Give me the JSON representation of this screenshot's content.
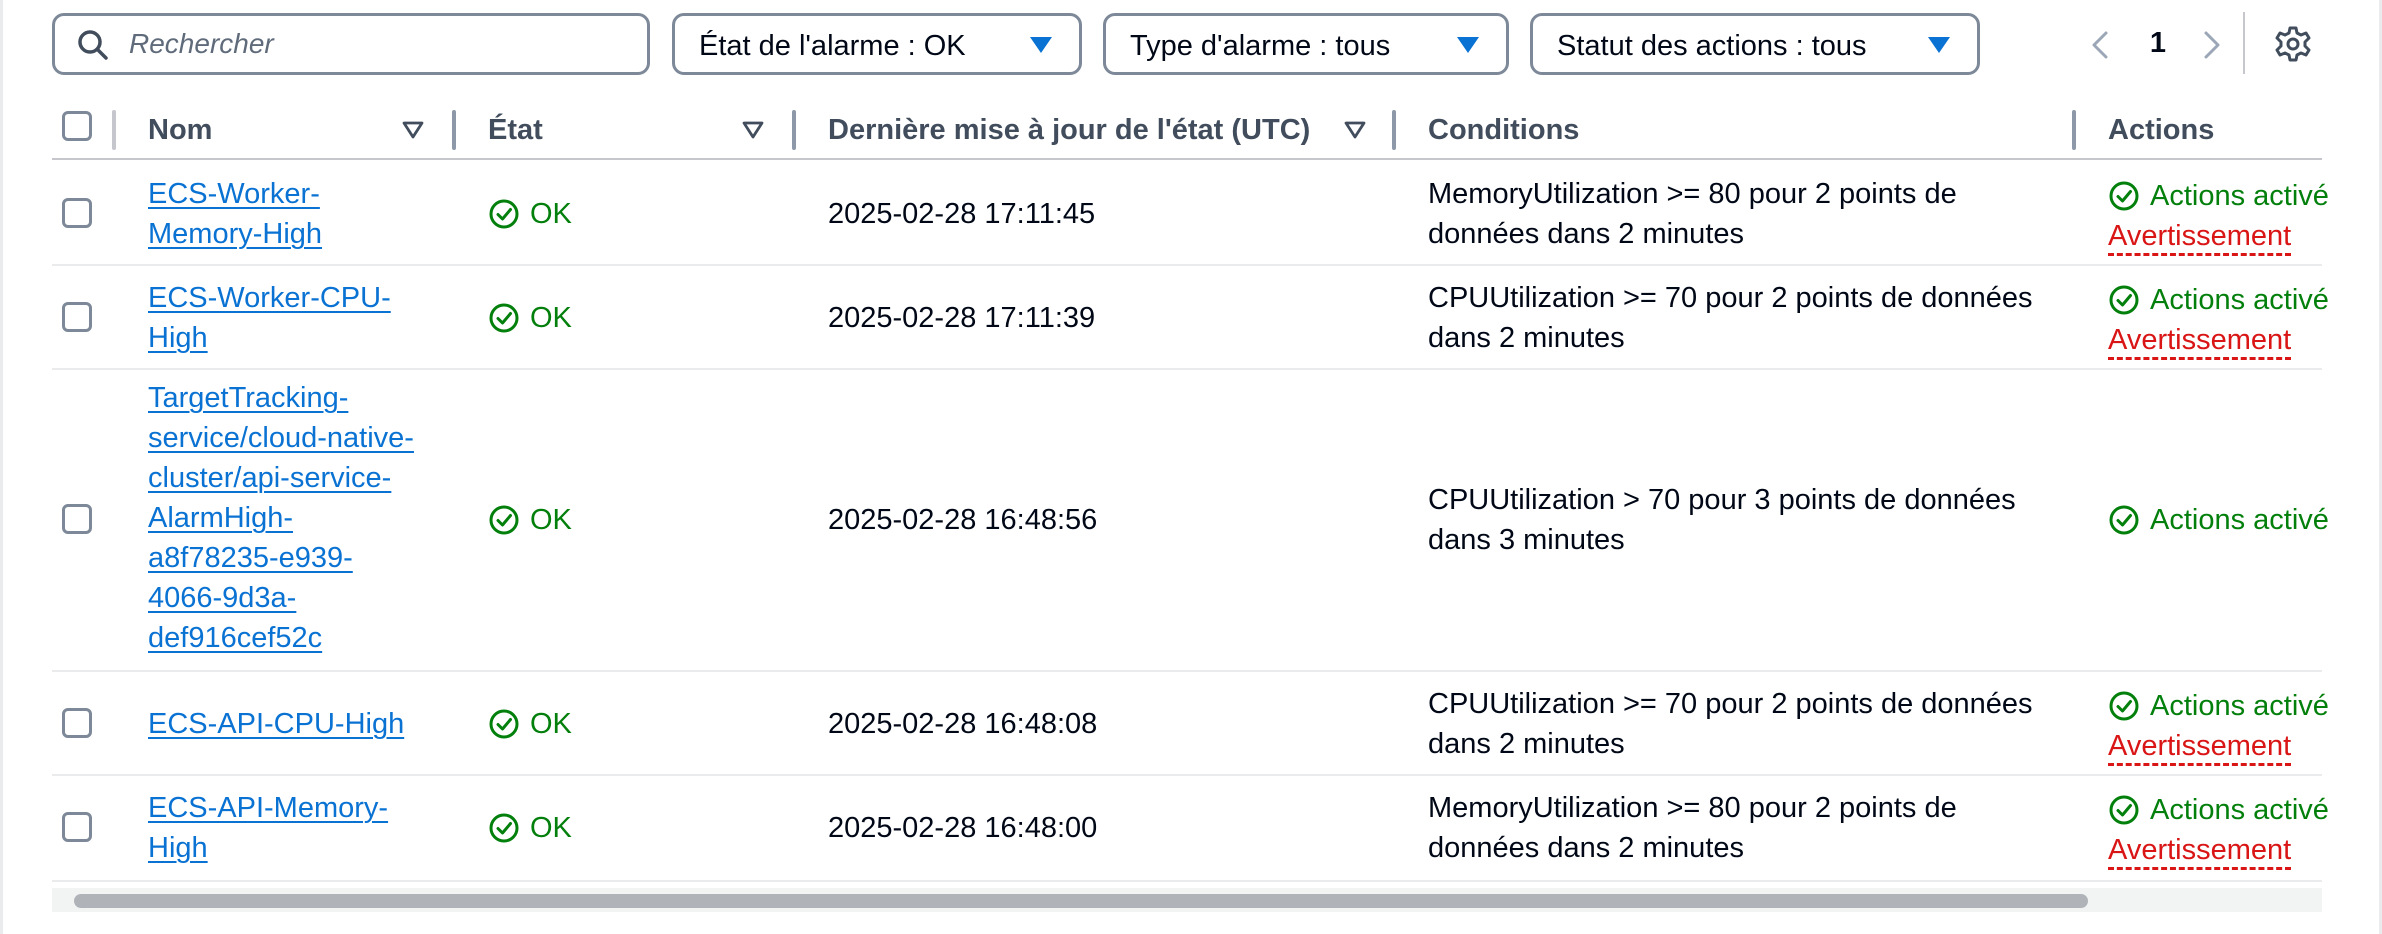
{
  "toolbar": {
    "search_placeholder": "Rechercher",
    "filter_state": "État de l'alarme : OK",
    "filter_type": "Type d'alarme : tous",
    "filter_actions": "Statut des actions : tous",
    "page": "1",
    "icons": [
      "search-icon",
      "caret-down-icon",
      "chevron-left-icon",
      "chevron-right-icon",
      "gear-icon"
    ]
  },
  "table": {
    "headers": {
      "name": "Nom",
      "state": "État",
      "updated": "Dernière mise à jour de l'état (UTC)",
      "conditions": "Conditions",
      "actions": "Actions"
    },
    "rows": [
      {
        "name_lines": [
          "ECS-Worker-",
          "Memory-High"
        ],
        "state": "OK",
        "updated": "2025-02-28 17:11:45",
        "condition_lines": [
          "MemoryUtilization >= 80 pour 2 points de",
          "données dans 2 minutes"
        ],
        "action": "Actions activé",
        "warning": "Avertissement"
      },
      {
        "name_lines": [
          "ECS-Worker-CPU-",
          "High"
        ],
        "state": "OK",
        "updated": "2025-02-28 17:11:39",
        "condition_lines": [
          "CPUUtilization >= 70 pour 2 points de données",
          "dans 2 minutes"
        ],
        "action": "Actions activé",
        "warning": "Avertissement"
      },
      {
        "name_lines": [
          "TargetTracking-",
          "service/cloud-native-",
          "cluster/api-service-",
          "AlarmHigh-",
          "a8f78235-e939-",
          "4066-9d3a-",
          "def916cef52c"
        ],
        "state": "OK",
        "updated": "2025-02-28 16:48:56",
        "condition_lines": [
          "CPUUtilization > 70 pour 3 points de données",
          "dans 3 minutes"
        ],
        "action": "Actions activé",
        "warning": ""
      },
      {
        "name_lines": [
          "ECS-API-CPU-High"
        ],
        "state": "OK",
        "updated": "2025-02-28 16:48:08",
        "condition_lines": [
          "CPUUtilization >= 70 pour 2 points de données",
          "dans 2 minutes"
        ],
        "action": "Actions activé",
        "warning": "Avertissement"
      },
      {
        "name_lines": [
          "ECS-API-Memory-",
          "High"
        ],
        "state": "OK",
        "updated": "2025-02-28 16:48:00",
        "condition_lines": [
          "MemoryUtilization >= 80 pour 2 points de",
          "données dans 2 minutes"
        ],
        "action": "Actions activé",
        "warning": "Avertissement"
      }
    ]
  },
  "colors": {
    "link": "#0972d3",
    "success": "#037f0c",
    "warning": "#d91515",
    "caret": "#0972d3",
    "border": "#7d8998"
  }
}
